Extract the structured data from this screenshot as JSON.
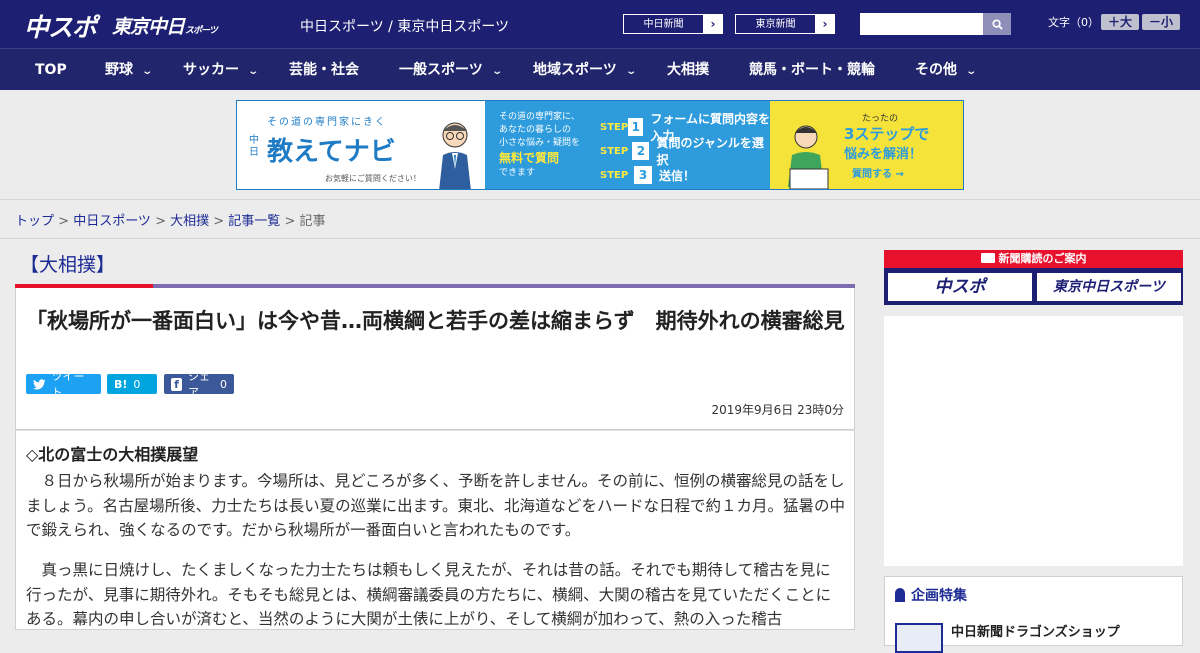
{
  "header": {
    "logo_chuspo": "中スポ",
    "logo_tokyo": "東京中日",
    "logo_tokyo_suffix": "スポーツ",
    "site_names": "中日スポーツ / 東京中日スポーツ",
    "paper_links": [
      {
        "label": "中日新聞"
      },
      {
        "label": "東京新聞"
      }
    ],
    "search": {
      "value": "",
      "icon": "search-icon"
    },
    "fontsize": {
      "label": "文字（0）",
      "larger": "＋大",
      "smaller": "－小"
    }
  },
  "nav": {
    "items": [
      {
        "label": "TOP",
        "has_menu": false
      },
      {
        "label": "野球",
        "has_menu": true
      },
      {
        "label": "サッカー",
        "has_menu": true
      },
      {
        "label": "芸能・社会",
        "has_menu": false
      },
      {
        "label": "一般スポーツ",
        "has_menu": true
      },
      {
        "label": "地域スポーツ",
        "has_menu": true
      },
      {
        "label": "大相撲",
        "has_menu": false
      },
      {
        "label": "競馬・ボート・競輪",
        "has_menu": false
      },
      {
        "label": "その他",
        "has_menu": true
      }
    ]
  },
  "ad_banner": {
    "kicker": "その道の専門家にきく",
    "small_brand": "中日",
    "brand": "教えてナビ",
    "note": "お気軽にご質問ください！",
    "mid_text": [
      "その道の専門家に、",
      "あなたの暮らしの",
      "小さな悩み・疑問を"
    ],
    "mid_highlight": "無料で質問",
    "mid_tail": "できます",
    "steps": [
      {
        "prefix": "STEP",
        "num": "1",
        "text": "フォームに質問内容を入力"
      },
      {
        "prefix": "STEP",
        "num": "2",
        "text": "質問のジャンルを選択"
      },
      {
        "prefix": "STEP",
        "num": "3",
        "text": "送信！"
      }
    ],
    "right_small": "たったの",
    "right_big": "3ステップで",
    "right_mid": "悩みを解消！",
    "cta": "質問する →"
  },
  "breadcrumb": {
    "items": [
      "トップ",
      "中日スポーツ",
      "大相撲",
      "記事一覧"
    ],
    "current": "記事",
    "sep": " > "
  },
  "article": {
    "category": "【大相撲】",
    "headline": "「秋場所が一番面白い」は今や昔…両横綱と若手の差は縮まらず　期待外れの横審総見",
    "share": {
      "tweet": "ツイート",
      "hatena_icon": "B!",
      "hatena_count": "0",
      "facebook_icon": "f",
      "facebook_label": "シェア",
      "facebook_count": "0"
    },
    "date": "2019年9月6日 23時0分",
    "subhead": "◇北の富士の大相撲展望",
    "paragraphs": [
      "　８日から秋場所が始まります。今場所は、見どころが多く、予断を許しません。その前に、恒例の横審総見の話をしましょう。名古屋場所後、力士たちは長い夏の巡業に出ます。東北、北海道などをハードな日程で約１カ月。猛暑の中で鍛えられ、強くなるのです。だから秋場所が一番面白いと言われたものです。",
      "　真っ黒に日焼けし、たくましくなった力士たちは頼もしく見えたが、それは昔の話。それでも期待して稽古を見に行ったが、見事に期待外れ。そもそも総見とは、横綱審議委員の方たちに、横綱、大関の稽古を見ていただくことにある。幕内の申し合いが済むと、当然のように大関が土俵に上がり、そして横綱が加わって、熱の入った稽古"
    ]
  },
  "sidebar": {
    "subscribe_title": "新聞購読のご案内",
    "subscribe_links": [
      "中スポ",
      "東京中日スポーツ"
    ],
    "feature_title": "企画特集",
    "feature_item": "中日新聞ドラゴンズショップ"
  },
  "colors": {
    "header_bg": "#1d1f73",
    "nav_bg": "#21256b",
    "link": "#1d2b94",
    "accent_red": "#e8112d",
    "accent_purple": "#7b6db0",
    "twitter": "#1da1f2",
    "hatena": "#00a4de",
    "facebook": "#3b5998"
  }
}
